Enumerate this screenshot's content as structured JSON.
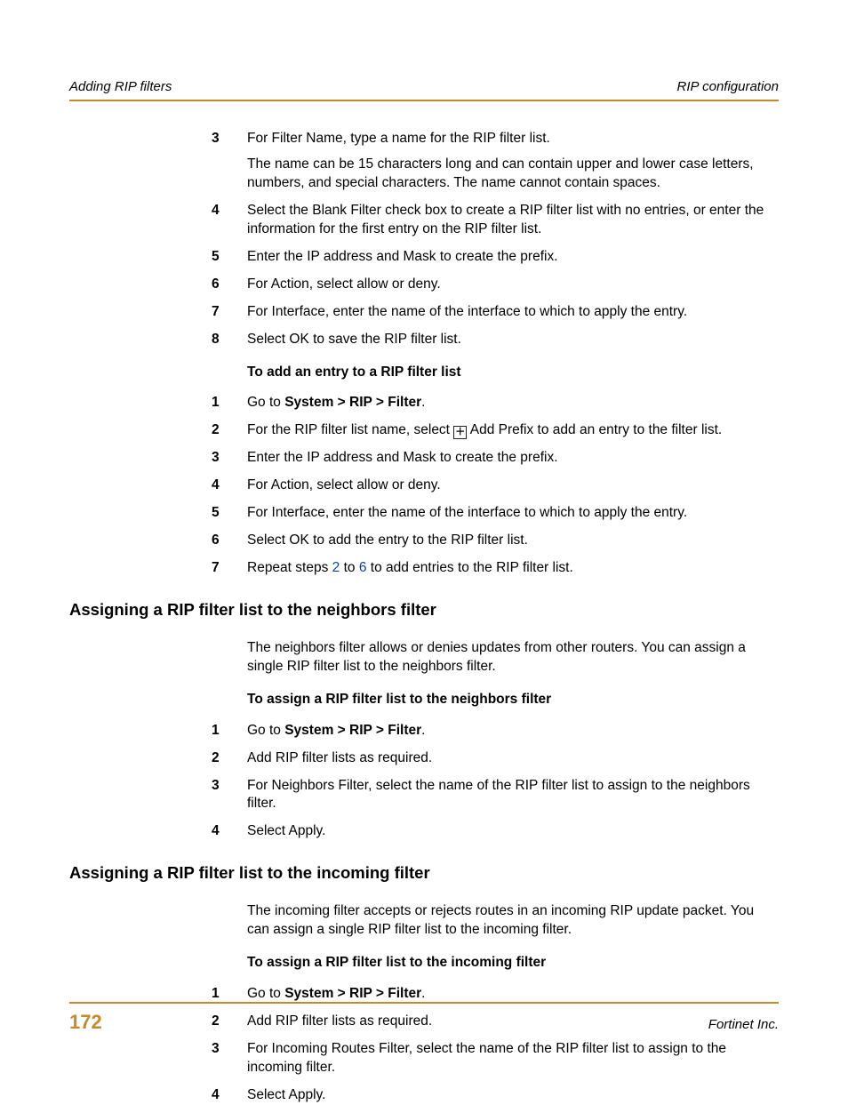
{
  "header": {
    "left": "Adding RIP filters",
    "right": "RIP configuration"
  },
  "top_steps": [
    {
      "n": "3",
      "lines": [
        "For Filter Name, type a name for the RIP filter list.",
        "The name can be 15 characters long and can contain upper and lower case letters, numbers, and special characters. The name cannot contain spaces."
      ]
    },
    {
      "n": "4",
      "lines": [
        "Select the Blank Filter check box to create a RIP filter list with no entries, or enter the information for the first entry on the RIP filter list."
      ]
    },
    {
      "n": "5",
      "lines": [
        "Enter the IP address and Mask to create the prefix."
      ]
    },
    {
      "n": "6",
      "lines": [
        "For Action, select allow or deny."
      ]
    },
    {
      "n": "7",
      "lines": [
        "For Interface, enter the name of the interface to which to apply the entry."
      ]
    },
    {
      "n": "8",
      "lines": [
        "Select OK to save the RIP filter list."
      ]
    }
  ],
  "add_entry": {
    "title": "To add an entry to a RIP filter list",
    "steps": {
      "s1": {
        "n": "1",
        "prefix": "Go to ",
        "nav": "System > RIP > Filter",
        "suffix": "."
      },
      "s2": {
        "n": "2",
        "prefix": "For the RIP filter list name, select ",
        "icon_glyph": "＋",
        "suffix": " Add Prefix to add an entry to the filter list."
      },
      "s3": {
        "n": "3",
        "text": "Enter the IP address and Mask to create the prefix."
      },
      "s4": {
        "n": "4",
        "text": "For Action, select allow or deny."
      },
      "s5": {
        "n": "5",
        "text": "For Interface, enter the name of the interface to which to apply the entry."
      },
      "s6": {
        "n": "6",
        "text": "Select OK to add the entry to the RIP filter list."
      },
      "s7": {
        "n": "7",
        "prefix": "Repeat steps ",
        "link1": "2",
        "mid": " to ",
        "link2": "6",
        "suffix": " to add entries to the RIP filter list."
      }
    }
  },
  "neighbors": {
    "heading": "Assigning a RIP filter list to the neighbors filter",
    "intro": "The neighbors filter allows or denies updates from other routers. You can assign a single RIP filter list to the neighbors filter.",
    "subhead": "To assign a RIP filter list to the neighbors filter",
    "steps": {
      "s1": {
        "n": "1",
        "prefix": "Go to ",
        "nav": "System > RIP > Filter",
        "suffix": "."
      },
      "s2": {
        "n": "2",
        "text": "Add RIP filter lists as required."
      },
      "s3": {
        "n": "3",
        "text": "For Neighbors Filter, select the name of the RIP filter list to assign to the neighbors filter."
      },
      "s4": {
        "n": "4",
        "text": "Select Apply."
      }
    }
  },
  "incoming": {
    "heading": "Assigning a RIP filter list to the incoming filter",
    "intro": "The incoming filter accepts or rejects routes in an incoming RIP update packet. You can assign a single RIP filter list to the incoming filter.",
    "subhead": "To assign a RIP filter list to the incoming filter",
    "steps": {
      "s1": {
        "n": "1",
        "prefix": "Go to ",
        "nav": "System > RIP > Filter",
        "suffix": "."
      },
      "s2": {
        "n": "2",
        "text": "Add RIP filter lists as required."
      },
      "s3": {
        "n": "3",
        "text": "For Incoming Routes Filter, select the name of the RIP filter list to assign to the incoming filter."
      },
      "s4": {
        "n": "4",
        "text": "Select Apply."
      }
    }
  },
  "footer": {
    "page": "172",
    "company": "Fortinet Inc."
  }
}
